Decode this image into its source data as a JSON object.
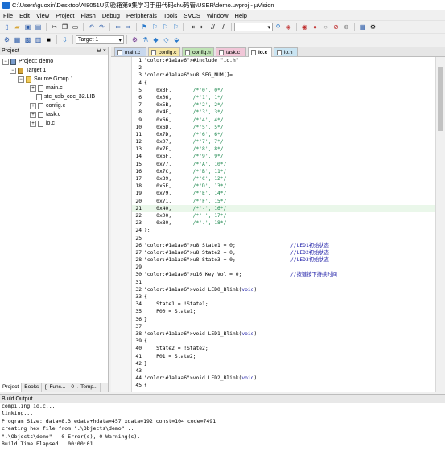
{
  "window": {
    "title": "C:\\Users\\guoxin\\Desktop\\AI8051U实验箱第9集学习手册代码shu码管\\USER\\demo.uvproj - µVision"
  },
  "menu": [
    "File",
    "Edit",
    "View",
    "Project",
    "Flash",
    "Debug",
    "Peripherals",
    "Tools",
    "SVCS",
    "Window",
    "Help"
  ],
  "toolbar": {
    "target_select": "Target 1"
  },
  "project_panel": {
    "title": "Project",
    "pin_label": "ㅂ",
    "close_label": "×",
    "tree": {
      "root": "Project: demo",
      "target": "Target 1",
      "group": "Source Group 1",
      "files": [
        "main.c",
        "stc_usb_cdc_32.LIB",
        "config.c",
        "task.c",
        "io.c"
      ]
    },
    "bottom_tabs": [
      "Project",
      "Books",
      "{} Func...",
      "0→ Temp..."
    ]
  },
  "editor": {
    "tabs": [
      {
        "label": "main.c",
        "color": "#c8d8ee"
      },
      {
        "label": "config.c",
        "color": "#f5e6a8"
      },
      {
        "label": "config.h",
        "color": "#bfe3b5"
      },
      {
        "label": "task.c",
        "color": "#f1c7d8"
      },
      {
        "label": "io.c",
        "color": "#ffffff",
        "active": true
      },
      {
        "label": "io.h",
        "color": "#c9e4f2"
      }
    ],
    "lines": [
      {
        "n": "1",
        "t": "#include \"io.h\""
      },
      {
        "n": "2",
        "t": ""
      },
      {
        "n": "3",
        "t": "u8 SEG_NUM[]="
      },
      {
        "n": "4",
        "t": "{"
      },
      {
        "n": "5",
        "t": "    0x3F,       /*'0', 0*/"
      },
      {
        "n": "6",
        "t": "    0x06,       /*'1', 1*/"
      },
      {
        "n": "7",
        "t": "    0x5B,       /*'2', 2*/"
      },
      {
        "n": "8",
        "t": "    0x4F,       /*'3', 3*/"
      },
      {
        "n": "9",
        "t": "    0x66,       /*'4', 4*/"
      },
      {
        "n": "10",
        "t": "    0x6D,       /*'5', 5*/"
      },
      {
        "n": "11",
        "t": "    0x7D,       /*'6', 6*/"
      },
      {
        "n": "12",
        "t": "    0x07,       /*'7', 7*/"
      },
      {
        "n": "13",
        "t": "    0x7F,       /*'8', 8*/"
      },
      {
        "n": "14",
        "t": "    0x6F,       /*'9', 9*/"
      },
      {
        "n": "15",
        "t": "    0x77,       /*'A', 10*/"
      },
      {
        "n": "16",
        "t": "    0x7C,       /*'B', 11*/"
      },
      {
        "n": "17",
        "t": "    0x39,       /*'C', 12*/"
      },
      {
        "n": "18",
        "t": "    0x5E,       /*'D', 13*/"
      },
      {
        "n": "19",
        "t": "    0x79,       /*'E', 14*/"
      },
      {
        "n": "20",
        "t": "    0x71,       /*'F', 15*/"
      },
      {
        "n": "21",
        "t": "    0x40,       /*'-', 16*/",
        "hl": true
      },
      {
        "n": "22",
        "t": "    0x00,       /*' ', 17*/"
      },
      {
        "n": "23",
        "t": "    0x80,       /*'.', 18*/"
      },
      {
        "n": "24",
        "t": "};"
      },
      {
        "n": "25",
        "t": ""
      },
      {
        "n": "26",
        "t": "u8 State1 = 0;                  //LED1初始状态"
      },
      {
        "n": "27",
        "t": "u8 State2 = 0;                  //LED2初始状态"
      },
      {
        "n": "28",
        "t": "u8 State3 = 0;                  //LED3初始状态"
      },
      {
        "n": "29",
        "t": ""
      },
      {
        "n": "30",
        "t": "u16 Key_Vol = 0;                //按键按下持续时间"
      },
      {
        "n": "31",
        "t": ""
      },
      {
        "n": "32",
        "t": "void LED0_Blink(void)"
      },
      {
        "n": "33",
        "t": "{"
      },
      {
        "n": "34",
        "t": "    State1 = !State1;"
      },
      {
        "n": "35",
        "t": "    P00 = State1;"
      },
      {
        "n": "36",
        "t": "}"
      },
      {
        "n": "37",
        "t": ""
      },
      {
        "n": "38",
        "t": "void LED1_Blink(void)"
      },
      {
        "n": "39",
        "t": "{"
      },
      {
        "n": "40",
        "t": "    State2 = !State2;"
      },
      {
        "n": "41",
        "t": "    P01 = State2;"
      },
      {
        "n": "42",
        "t": "}"
      },
      {
        "n": "43",
        "t": ""
      },
      {
        "n": "44",
        "t": "void LED2_Blink(void)"
      },
      {
        "n": "45",
        "t": "{"
      }
    ]
  },
  "build_output": {
    "title": "Build Output",
    "lines": [
      "compiling io.c...",
      "linking...",
      "Program Size: data=8.3 edata+hdata=457 xdata=192 const=104 code=7491",
      "creating hex file from \".\\Objects\\demo\"...",
      "\".\\Objects\\demo\" - 0 Error(s), 0 Warning(s).",
      "Build Time Elapsed:  00:00:01"
    ]
  }
}
